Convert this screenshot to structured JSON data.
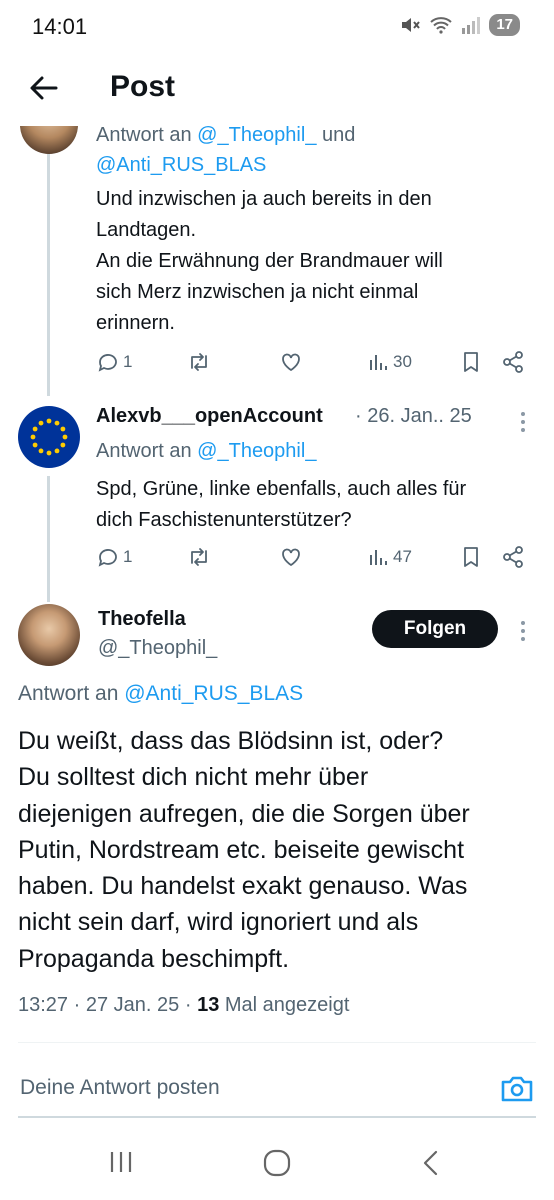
{
  "status_bar": {
    "time": "14:01",
    "battery": "17",
    "icons": [
      "mute-icon",
      "wifi-icon",
      "signal-icon"
    ]
  },
  "header": {
    "title": "Post",
    "back_icon": "arrow-left-icon"
  },
  "reply1": {
    "reply_prefix": "Antwort an",
    "reply_to_1": "@_Theophil_",
    "reply_and": "und",
    "reply_to_2": "@Anti_RUS_BLAS",
    "lines": [
      "Und inzwischen ja auch bereits in den",
      "Landtagen.",
      "An die Erwähnung der Brandmauer will",
      "sich Merz inzwischen ja nicht einmal",
      "erinnern."
    ],
    "replies": "1",
    "views": "30"
  },
  "reply2": {
    "name": "Alexvb___openAccount",
    "date": "· 26. Jan.. 25",
    "reply_prefix": "Antwort an",
    "reply_to": "@_Theophil_",
    "lines": [
      "Spd, Grüne, linke ebenfalls, auch alles für",
      "dich Faschistenunterstützer?"
    ],
    "replies": "1",
    "views": "47"
  },
  "main_post": {
    "name": "Theofella",
    "handle": "@_Theophil_",
    "follow_label": "Folgen",
    "reply_prefix": "Antwort an",
    "reply_to": "@Anti_RUS_BLAS",
    "lines": [
      "Du weißt, dass das Blödsinn ist, oder?",
      "Du solltest dich nicht mehr über",
      "diejenigen aufregen, die die Sorgen über",
      "Putin, Nordstream etc. beiseite gewischt",
      "haben. Du handelst exakt genauso. Was",
      "nicht sein darf, wird ignoriert und als",
      "Propaganda beschimpft."
    ],
    "time": "13:27",
    "date": "27 Jan. 25",
    "sep": "·",
    "views_count": "13",
    "views_label": "Mal angezeigt"
  },
  "compose": {
    "placeholder": "Deine Antwort posten",
    "icon": "camera-icon"
  },
  "nav": {
    "icons": [
      "recents-icon",
      "home-icon",
      "back-icon"
    ]
  },
  "colors": {
    "link": "#1d9bf0",
    "muted": "#536471",
    "text": "#0f1419",
    "eu_blue": "#003399",
    "eu_star": "#ffcc00"
  }
}
